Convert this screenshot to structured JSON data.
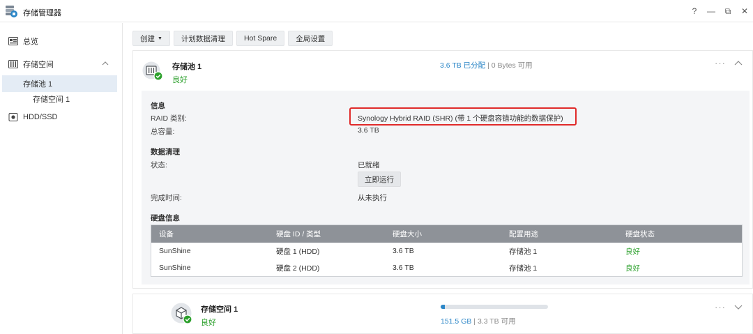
{
  "window": {
    "title": "存储管理器",
    "controls": [
      "?",
      "—",
      "⧉",
      "✕"
    ]
  },
  "sidebar": {
    "items": [
      {
        "label": "总览",
        "icon": "overview-icon"
      },
      {
        "label": "存储空间",
        "icon": "storage-icon"
      },
      {
        "label": "存储池 1"
      },
      {
        "label": "存储空间 1"
      },
      {
        "label": "HDD/SSD",
        "icon": "hdd-icon"
      }
    ]
  },
  "toolbar": {
    "create_label": "创建",
    "scrub_label": "计划数据清理",
    "hotspare_label": "Hot Spare",
    "global_label": "全局设置"
  },
  "pool": {
    "name": "存储池 1",
    "status": "良好",
    "allocated": "3.6 TB 已分配",
    "separator": " | ",
    "available": "0 Bytes 可用",
    "info_title": "信息",
    "raid_label": "RAID 类别:",
    "raid_value": "Synology Hybrid RAID (SHR) (带 1 个硬盘容错功能的数据保护)",
    "capacity_label": "总容量:",
    "capacity_value": "3.6 TB",
    "scrub_title": "数据清理",
    "state_label": "状态:",
    "state_value": "已就绪",
    "run_label": "立即运行",
    "done_label": "完成时间:",
    "done_value": "从未执行",
    "disk_title": "硬盘信息"
  },
  "disk_table": {
    "headers": [
      "设备",
      "硬盘 ID / 类型",
      "硬盘大小",
      "配置用途",
      "硬盘状态"
    ],
    "rows": [
      [
        "SunShine",
        "硬盘 1 (HDD)",
        "3.6 TB",
        "存储池 1",
        "良好"
      ],
      [
        "SunShine",
        "硬盘 2 (HDD)",
        "3.6 TB",
        "存储池 1",
        "良好"
      ]
    ]
  },
  "volume": {
    "name": "存储空间 1",
    "status": "良好",
    "used": "151.5 GB",
    "separator": " | ",
    "available": "3.3 TB 可用",
    "usage_fraction": 0.04
  },
  "colors": {
    "accent": "#2b86c7",
    "good": "#2ca02c",
    "highlight": "#e02a2a",
    "table_header": "#8e9298"
  }
}
